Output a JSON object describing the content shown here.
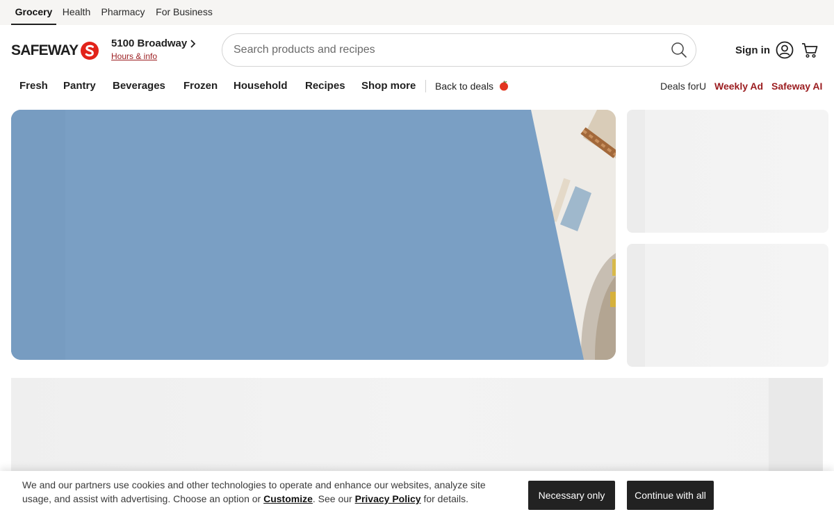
{
  "topbar": {
    "tabs": [
      {
        "label": "Grocery"
      },
      {
        "label": "Health"
      },
      {
        "label": "Pharmacy"
      },
      {
        "label": "For Business"
      }
    ],
    "active_tab": "Grocery"
  },
  "header": {
    "logo_text": "SAFEWAY",
    "store_name": "5100 Broadway",
    "store_link": "Hours & info",
    "search_placeholder": "Search products and recipes",
    "signin_label": "Sign in"
  },
  "nav": {
    "items": [
      {
        "label": "Fresh"
      },
      {
        "label": "Pantry"
      },
      {
        "label": "Beverages"
      },
      {
        "label": "Frozen"
      },
      {
        "label": "Household"
      },
      {
        "label": "Recipes"
      },
      {
        "label": "Shop more"
      }
    ],
    "back_to_deals": "Back to deals",
    "right": [
      {
        "label": "Deals forU"
      },
      {
        "label": "Weekly Ad"
      },
      {
        "label": "Safeway AI"
      }
    ]
  },
  "cookie_banner": {
    "text_before": "We and our partners use cookies and other technologies to operate and enhance our websites, analyze site usage, and assist with advertising. Choose an option or ",
    "customize_label": "Customize",
    "text_middle": ". See our ",
    "privacy_label": "Privacy Policy",
    "text_after": " for details.",
    "necessary_label": "Necessary only",
    "continue_label": "Continue with all"
  },
  "colors": {
    "brand_red": "#9b1c1f",
    "hero_blue": "#7a9fc4",
    "button_dark": "#222222"
  },
  "icons": [
    "search-icon",
    "user-icon",
    "cart-icon",
    "chevron-right-icon",
    "apple-icon",
    "safeway-s-logo-icon"
  ]
}
